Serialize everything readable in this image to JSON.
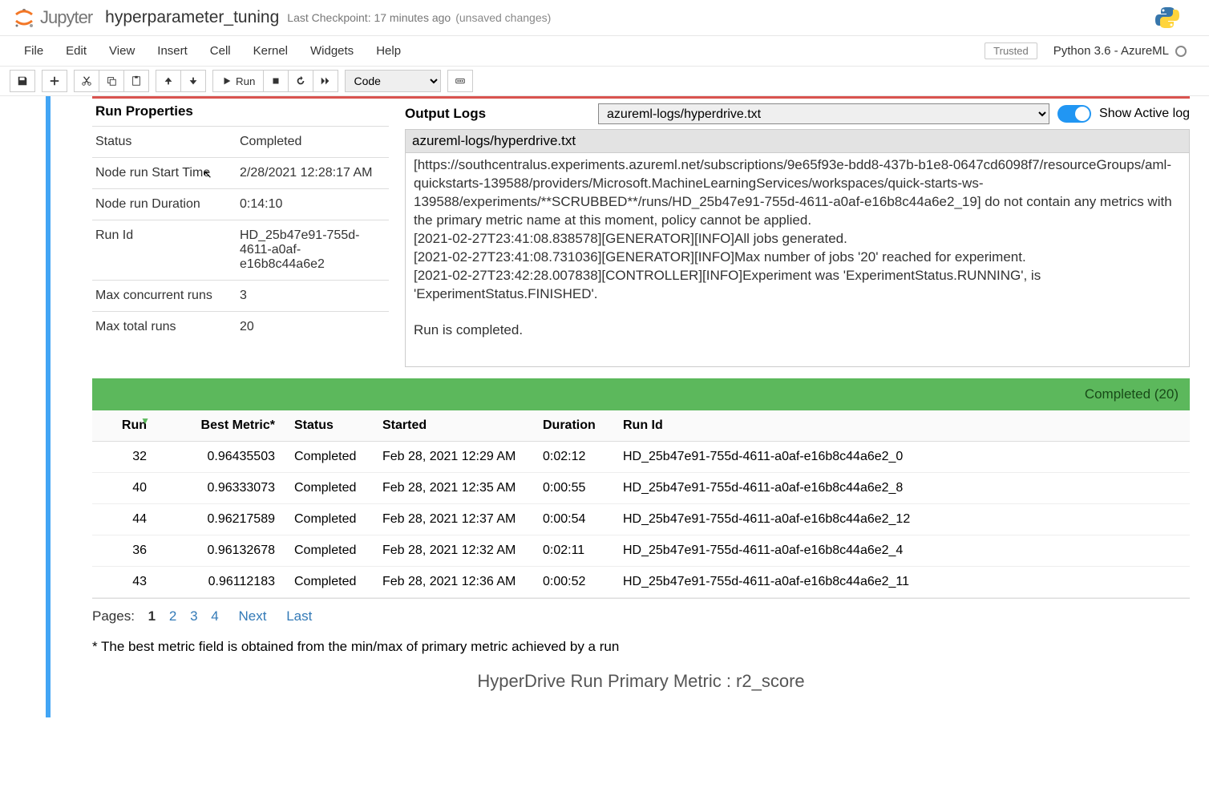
{
  "header": {
    "logo_text": "Jupyter",
    "notebook_name": "hyperparameter_tuning",
    "checkpoint": "Last Checkpoint: 17 minutes ago",
    "unsaved": "(unsaved changes)"
  },
  "menubar": {
    "file": "File",
    "edit": "Edit",
    "view": "View",
    "insert": "Insert",
    "cell": "Cell",
    "kernel": "Kernel",
    "widgets": "Widgets",
    "help": "Help",
    "trusted": "Trusted",
    "kernel_name": "Python 3.6 - AzureML"
  },
  "toolbar": {
    "run_label": "Run",
    "cell_type": "Code"
  },
  "run_properties": {
    "heading": "Run Properties",
    "status_label": "Status",
    "status_value": "Completed",
    "start_label": "Node run Start Time",
    "start_value": "2/28/2021 12:28:17 AM",
    "duration_label": "Node run Duration",
    "duration_value": "0:14:10",
    "runid_label": "Run Id",
    "runid_value": "HD_25b47e91-755d-4611-a0af-e16b8c44a6e2",
    "maxconc_label": "Max concurrent runs",
    "maxconc_value": "3",
    "maxtotal_label": "Max total runs",
    "maxtotal_value": "20"
  },
  "output_logs": {
    "heading": "Output Logs",
    "select_value": "azureml-logs/hyperdrive.txt",
    "show_active": "Show Active log",
    "path_display": "azureml-logs/hyperdrive.txt",
    "body": "[https://southcentralus.experiments.azureml.net/subscriptions/9e65f93e-bdd8-437b-b1e8-0647cd6098f7/resourceGroups/aml-quickstarts-139588/providers/Microsoft.MachineLearningServices/workspaces/quick-starts-ws-139588/experiments/**SCRUBBED**/runs/HD_25b47e91-755d-4611-a0af-e16b8c44a6e2_19] do not contain any metrics with the primary metric name at this moment, policy cannot be applied.\n[2021-02-27T23:41:08.838578][GENERATOR][INFO]All jobs generated.\n[2021-02-27T23:41:08.731036][GENERATOR][INFO]Max number of jobs '20' reached for experiment.\n[2021-02-27T23:42:28.007838][CONTROLLER][INFO]Experiment was 'ExperimentStatus.RUNNING', is 'ExperimentStatus.FINISHED'.\n\nRun is completed."
  },
  "completed_bar": "Completed (20)",
  "table": {
    "headers": {
      "run": "Run",
      "best_metric": "Best Metric*",
      "status": "Status",
      "started": "Started",
      "duration": "Duration",
      "run_id": "Run Id"
    },
    "rows": [
      {
        "run": "32",
        "metric": "0.96435503",
        "status": "Completed",
        "started": "Feb 28, 2021 12:29 AM",
        "duration": "0:02:12",
        "run_id": "HD_25b47e91-755d-4611-a0af-e16b8c44a6e2_0"
      },
      {
        "run": "40",
        "metric": "0.96333073",
        "status": "Completed",
        "started": "Feb 28, 2021 12:35 AM",
        "duration": "0:00:55",
        "run_id": "HD_25b47e91-755d-4611-a0af-e16b8c44a6e2_8"
      },
      {
        "run": "44",
        "metric": "0.96217589",
        "status": "Completed",
        "started": "Feb 28, 2021 12:37 AM",
        "duration": "0:00:54",
        "run_id": "HD_25b47e91-755d-4611-a0af-e16b8c44a6e2_12"
      },
      {
        "run": "36",
        "metric": "0.96132678",
        "status": "Completed",
        "started": "Feb 28, 2021 12:32 AM",
        "duration": "0:02:11",
        "run_id": "HD_25b47e91-755d-4611-a0af-e16b8c44a6e2_4"
      },
      {
        "run": "43",
        "metric": "0.96112183",
        "status": "Completed",
        "started": "Feb 28, 2021 12:36 AM",
        "duration": "0:00:52",
        "run_id": "HD_25b47e91-755d-4611-a0af-e16b8c44a6e2_11"
      }
    ]
  },
  "pager": {
    "label": "Pages:",
    "current": "1",
    "pages": [
      "2",
      "3",
      "4"
    ],
    "next": "Next",
    "last": "Last"
  },
  "footnote": "* The best metric field is obtained from the min/max of primary metric achieved by a run",
  "chart_title": "HyperDrive Run Primary Metric : r2_score"
}
